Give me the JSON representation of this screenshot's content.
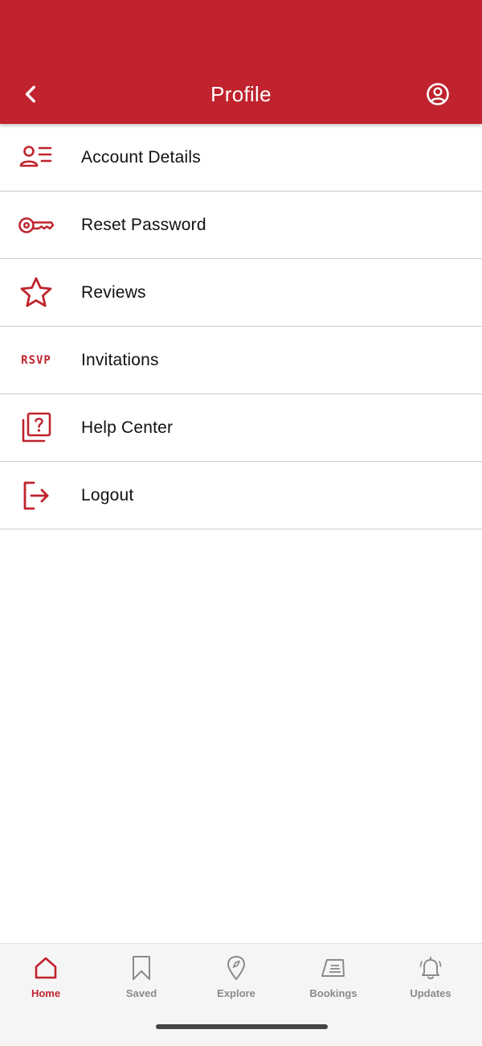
{
  "header": {
    "title": "Profile",
    "background_color": "#c0232d",
    "back_icon": "chevron-left-icon",
    "profile_icon": "user-circle-icon"
  },
  "menu": {
    "items": [
      {
        "label": "Account Details",
        "icon": "account-details-icon"
      },
      {
        "label": "Reset Password",
        "icon": "key-icon"
      },
      {
        "label": "Reviews",
        "icon": "star-icon"
      },
      {
        "label": "Invitations",
        "icon": "rsvp-icon",
        "icon_text": "RSVP"
      },
      {
        "label": "Help Center",
        "icon": "help-center-icon"
      },
      {
        "label": "Logout",
        "icon": "logout-icon"
      }
    ]
  },
  "bottom_nav": {
    "items": [
      {
        "label": "Home",
        "icon": "home-icon",
        "active": true
      },
      {
        "label": "Saved",
        "icon": "bookmark-icon",
        "active": false
      },
      {
        "label": "Explore",
        "icon": "location-pin-icon",
        "active": false
      },
      {
        "label": "Bookings",
        "icon": "ticket-icon",
        "active": false
      },
      {
        "label": "Updates",
        "icon": "bell-icon",
        "active": false
      }
    ]
  },
  "colors": {
    "accent": "#c0232d",
    "inactive_nav": "#8a8a8a",
    "divider": "#c9c9c9"
  }
}
